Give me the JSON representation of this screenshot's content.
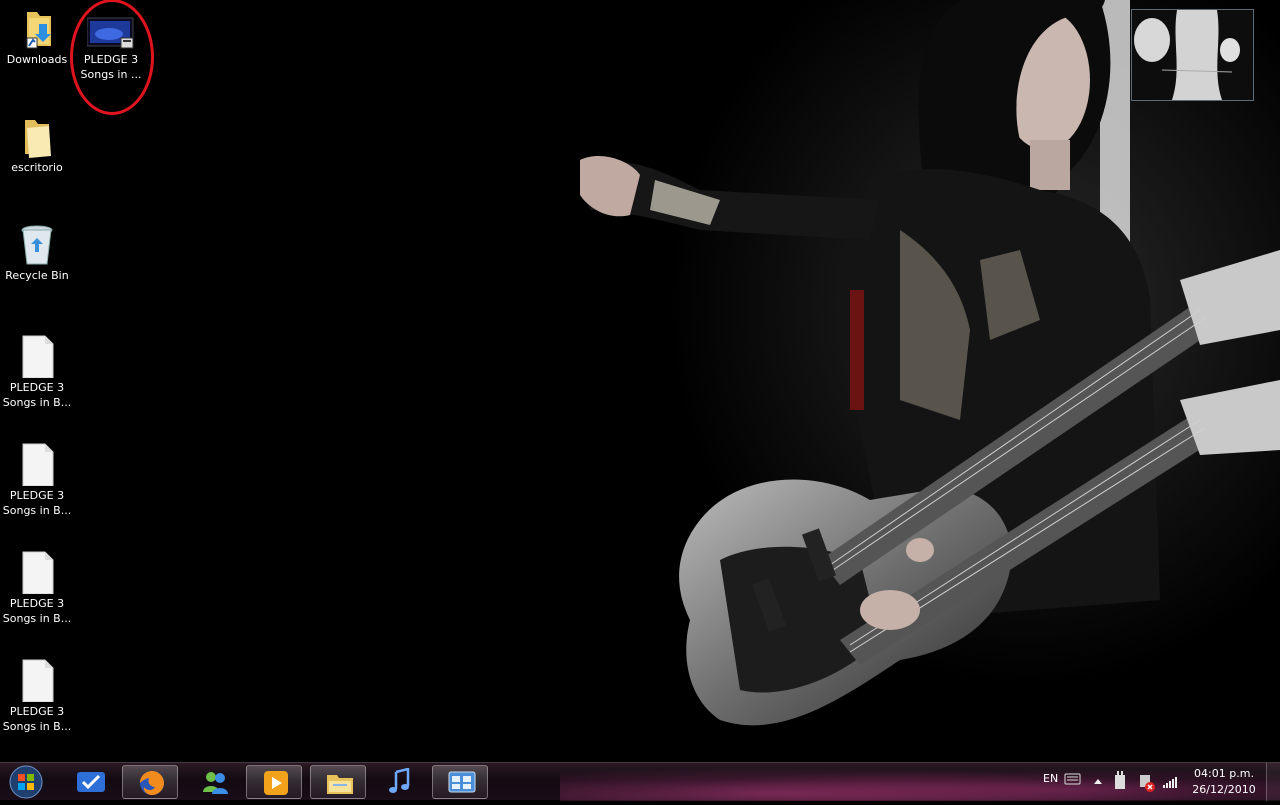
{
  "desktop": {
    "icons": [
      {
        "label": "Downloads",
        "icon": "downloads-folder-shortcut-icon"
      },
      {
        "label": "PLEDGE 3\nSongs in ...",
        "icon": "video-file-icon"
      },
      {
        "label": "escritorio",
        "icon": "folder-icon"
      },
      {
        "label": "Recycle Bin",
        "icon": "recycle-bin-icon"
      },
      {
        "label": "PLEDGE 3\nSongs in B...",
        "icon": "blank-file-icon"
      },
      {
        "label": "PLEDGE 3\nSongs in B...",
        "icon": "blank-file-icon"
      },
      {
        "label": "PLEDGE 3\nSongs in B...",
        "icon": "blank-file-icon"
      },
      {
        "label": "PLEDGE 3\nSongs in B...",
        "icon": "blank-file-icon"
      }
    ]
  },
  "taskbar": {
    "pinned": [
      {
        "name": "start-button",
        "icon": "windows-orb-icon"
      },
      {
        "name": "taskbar-app-checkmark",
        "icon": "checkmark-app-icon"
      },
      {
        "name": "taskbar-app-firefox",
        "icon": "firefox-icon",
        "active": true
      },
      {
        "name": "taskbar-app-messenger",
        "icon": "messenger-icon"
      },
      {
        "name": "taskbar-app-media-player",
        "icon": "media-player-icon",
        "active": true
      },
      {
        "name": "taskbar-app-explorer",
        "icon": "folder-explorer-icon",
        "active": true
      },
      {
        "name": "taskbar-app-music",
        "icon": "music-note-icon"
      },
      {
        "name": "taskbar-app-control-panel",
        "icon": "control-panel-icon",
        "active": true
      }
    ],
    "tray": {
      "language": "EN",
      "icons": [
        "keyboard-icon",
        "show-hidden-icons-arrow-icon",
        "power-icon",
        "network-disconnected-icon",
        "signal-strength-icon"
      ],
      "time": "04:01 p.m.",
      "date": "26/12/2010"
    }
  }
}
